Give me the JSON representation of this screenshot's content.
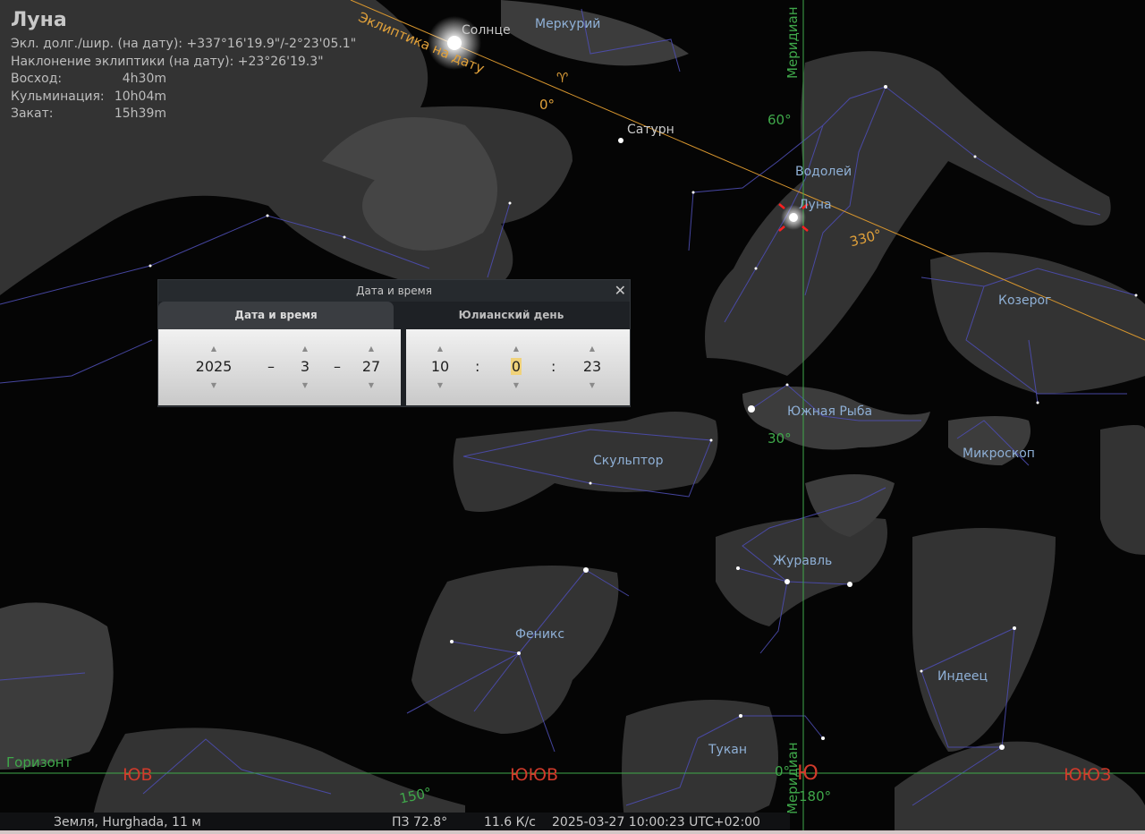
{
  "object_info": {
    "name": "Луна",
    "ecl_coords": "Экл. долг./шир. (на дату): +337°16'19.9\"/-2°23'05.1\"",
    "ecl_tilt": "Наклонение эклиптики (на дату): +23°26'19.3\"",
    "rise_label": "Восход:",
    "rise_value": "4h30m",
    "culm_label": "Кульминация:",
    "culm_value": "10h04m",
    "set_label": "Закат:",
    "set_value": "15h39m"
  },
  "sky_labels": {
    "sun": "Солнце",
    "mercury": "Меркурий",
    "saturn": "Сатурн",
    "moon": "Луна",
    "aquarius": "Водолей",
    "capricorn": "Козерог",
    "piscis_austrinus": "Южная Рыба",
    "sculptor": "Скульптор",
    "microscopium": "Микроскоп",
    "grus": "Журавль",
    "phoenix": "Феникс",
    "indus": "Индеец",
    "tucana": "Тукан",
    "ecliptic": "Эклиптика на дату",
    "meridian": "Меридиан",
    "horizon": "Горизонт",
    "aries_symbol": "♈",
    "ecl_0": "0°",
    "ecl_330": "330°",
    "mer_60": "60°",
    "mer_30": "30°",
    "hor_150": "150°",
    "hor_180": "180°",
    "hor_0": "0°",
    "card_sse": "ЮВ",
    "card_ssse": "ЮЮВ",
    "card_s": "Ю",
    "card_ssw": "ЮЮЗ"
  },
  "dialog": {
    "title": "Дата и время",
    "close": "✕",
    "tab_datetime": "Дата и время",
    "tab_julian": "Юлианский день",
    "year": "2025",
    "month": "3",
    "day": "27",
    "hour": "10",
    "minute": "0",
    "second": "23",
    "date_sep": "–",
    "time_sep": ":",
    "up": "▲",
    "down": "▼"
  },
  "status": {
    "location": "Земля, Hurghada, 11 м",
    "fov": "ПЗ 72.8°",
    "fps": "11.6 К/с",
    "datetime": "2025-03-27 10:00:23 UTC+02:00"
  },
  "colors": {
    "constellation_lines": "#4c4cb0",
    "ecliptic": "#d8962e",
    "meridian": "#3fa84a",
    "horizon": "#3fa84a",
    "cardinal": "#d23b2b",
    "label": "#8fb0d6",
    "moon_marker": "#ff2020"
  }
}
